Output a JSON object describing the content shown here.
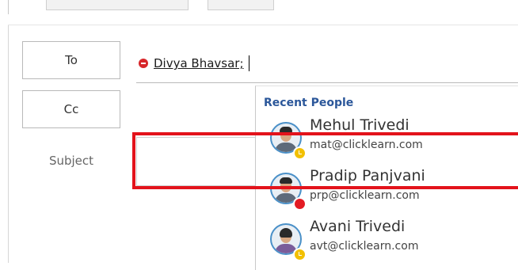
{
  "compose": {
    "to_label": "To",
    "cc_label": "Cc",
    "subject_label": "Subject",
    "recipient_name": "Divya Bhavsar;",
    "subject_value": ""
  },
  "suggestions": {
    "header": "Recent People",
    "people": [
      {
        "name": "Mehul Trivedi",
        "email": "mat@clicklearn.com",
        "presence": "away",
        "presence_icon": "clock-icon"
      },
      {
        "name": "Pradip Panjvani",
        "email": "prp@clicklearn.com",
        "presence": "busy",
        "presence_icon": "busy-dot-icon"
      },
      {
        "name": "Avani Trivedi",
        "email": "avt@clicklearn.com",
        "presence": "away",
        "presence_icon": "clock-icon"
      }
    ]
  },
  "colors": {
    "accent_header": "#2b579a",
    "highlight": "#e3131b",
    "remove_icon": "#d7262a",
    "presence_away": "#f2c000",
    "presence_busy": "#e31b23"
  }
}
